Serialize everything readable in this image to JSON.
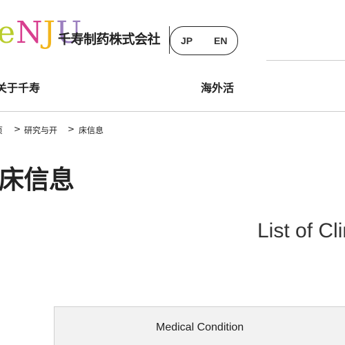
{
  "header": {
    "logo_text": [
      "e",
      "N",
      "J",
      "U"
    ],
    "company_name": "千寿制药株式会社",
    "language": {
      "jp_label": "JP",
      "en_label": "EN"
    }
  },
  "nav": {
    "about_label": "关于千寿",
    "overseas_label": "海外活"
  },
  "breadcrumb": {
    "home": "页",
    "separator": ">",
    "research": "研究与开",
    "current": "床信息"
  },
  "page": {
    "title": "床信息",
    "section_heading": "List of Clin"
  },
  "table": {
    "headers": [
      "Medical Condition"
    ]
  },
  "colors": {
    "logo_green": "#b9cc2c",
    "logo_pink": "#d83f8f",
    "logo_yellow": "#f2b51c",
    "logo_purple": "#9b7fbf",
    "table_header_bg": "#f2f2f2"
  }
}
